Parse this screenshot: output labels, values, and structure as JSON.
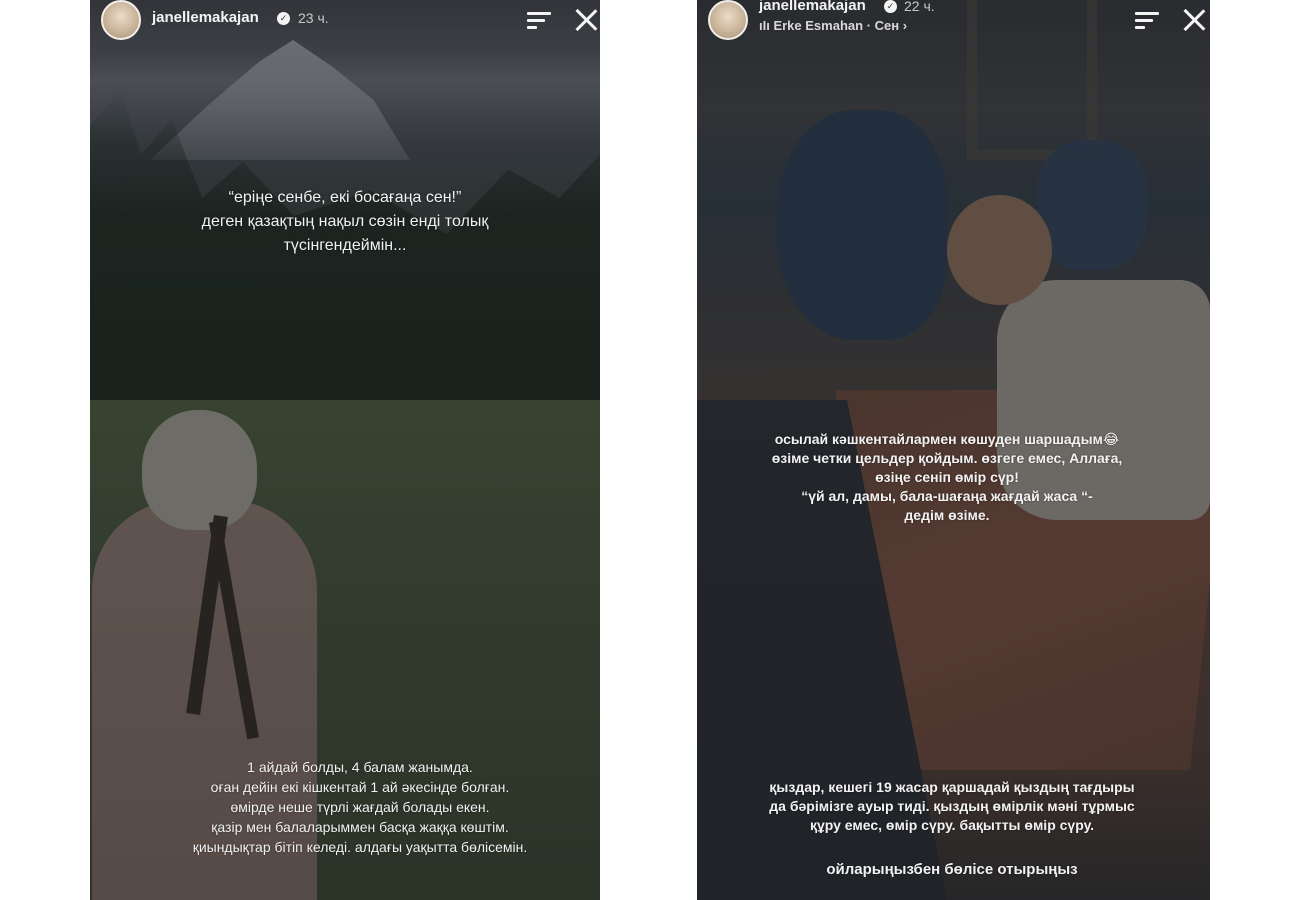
{
  "left_story": {
    "username": "janellemakajan",
    "time_ago": "23 ч.",
    "quote_text": "“еріңе сенбе, екі босағаңа сен!”\nдеген қазақтың нақыл сөзін енді толық\nтүсінгендеймін...",
    "bottom_text": "1 айдай болды, 4 балам жанымда.\nоған дейін екі кішкентай 1 ай әкесінде болған.\nөмірде неше түрлі жағдай болады екен.\nқазір мен балаларыммен басқа жаққа көштім.\nқиындықтар бітіп келеді. алдағы уақытта бөлісемін."
  },
  "right_story": {
    "username": "janellemakajan",
    "time_ago": "22 ч.",
    "music_label": "Erke Esmahan · Сен ›",
    "middle_text": "осылай кәшкентайлармен көшуден шаршадым😂\nөзіме четки цельдер қойдым. өзгеге емес, Аллаға,\nөзіңе сеніп өмір сүр!\n“үй ал, дамы, бала-шағаңа жағдай жаса “-\nдедім өзіме.",
    "bottom_text": "қыздар, кешегі 19 жасар қаршадай қыздың тағдыры\nда бәрімізге ауыр тиді. қыздың өмірлік мәні тұрмыс\nқұру емес, өмір сүру. бақытты өмір сүру.",
    "footer_text": "ойларыңызбен бөлісе отырыңыз"
  },
  "icons": {
    "verified": "verified-badge-icon",
    "menu": "menu-icon",
    "close": "close-icon",
    "music": "music-icon"
  }
}
